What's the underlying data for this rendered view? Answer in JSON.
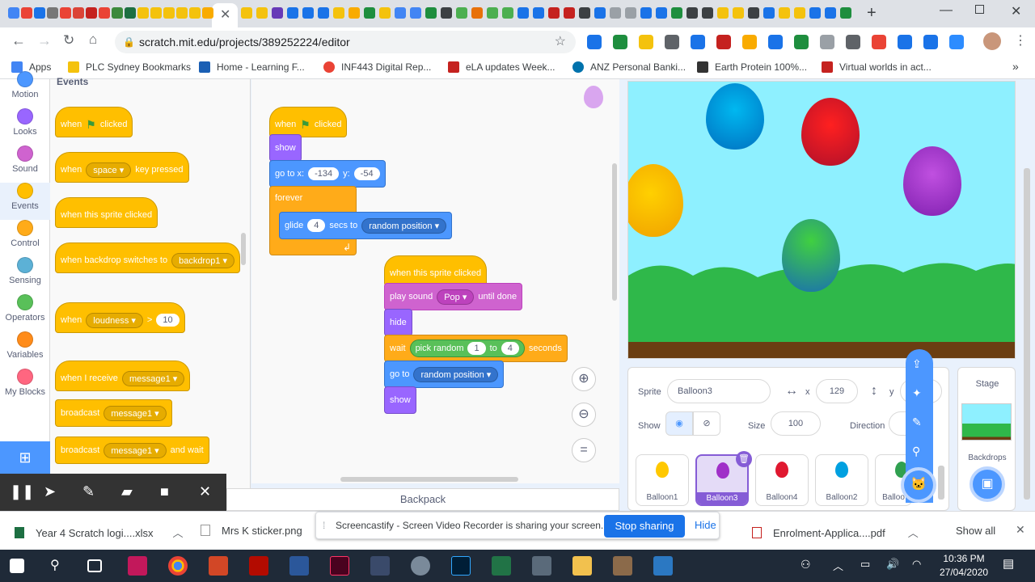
{
  "browser": {
    "url": "scratch.mit.edu/projects/389252224/editor",
    "bookmarks": [
      "Apps",
      "PLC Sydney Bookmarks",
      "Home - Learning F...",
      "INF443 Digital Rep...",
      "eLA updates Week...",
      "ANZ Personal Banki...",
      "Earth Protein 100%...",
      "Virtual worlds in act..."
    ],
    "more_bookmarks": "»"
  },
  "categories": [
    "Motion",
    "Looks",
    "Sound",
    "Events",
    "Control",
    "Sensing",
    "Operators",
    "Variables",
    "My Blocks"
  ],
  "category_colors": [
    "#4c97ff",
    "#9966ff",
    "#cf63cf",
    "#ffbf00",
    "#ffab19",
    "#5cb1d6",
    "#59c059",
    "#ff8c1a",
    "#ff6680"
  ],
  "palette": {
    "heading": "Events",
    "when_flag": [
      "when",
      "clicked"
    ],
    "when_key": [
      "when",
      "space",
      "key pressed"
    ],
    "when_sprite": "when this sprite clicked",
    "when_backdrop": [
      "when backdrop switches to",
      "backdrop1"
    ],
    "when_loudness": [
      "when",
      "loudness",
      ">",
      "10"
    ],
    "when_receive": [
      "when I receive",
      "message1"
    ],
    "broadcast": [
      "broadcast",
      "message1"
    ],
    "broadcast_wait": [
      "broadcast",
      "message1",
      "and wait"
    ]
  },
  "script1": {
    "hat": [
      "when",
      "clicked"
    ],
    "show": "show",
    "goto": [
      "go to x:",
      "-134",
      "y:",
      "-54"
    ],
    "forever": "forever",
    "glide": [
      "glide",
      "4",
      "secs to",
      "random position"
    ]
  },
  "script2": {
    "hat": "when this sprite clicked",
    "play": [
      "play sound",
      "Pop",
      "until done"
    ],
    "hide": "hide",
    "wait": [
      "wait",
      "pick random",
      "1",
      "to",
      "4",
      "seconds"
    ],
    "goto": [
      "go to",
      "random position"
    ],
    "show": "show"
  },
  "backpack": "Backpack",
  "sprite_info": {
    "sprite_label": "Sprite",
    "sprite_name": "Balloon3",
    "x_label": "x",
    "x_value": "129",
    "y_label": "y",
    "show_label": "Show",
    "size_label": "Size",
    "size_value": "100",
    "direction_label": "Direction"
  },
  "sprites": [
    "Balloon1",
    "Balloon3",
    "Balloon4",
    "Balloon2",
    "Balloo"
  ],
  "stage_panel": {
    "title": "Stage",
    "backdrops_label": "Backdrops"
  },
  "downloads": [
    "Year 4 Scratch logi....xlsx",
    "Mrs K sticker.png",
    "Enrolment-Applica....pdf"
  ],
  "show_all": "Show all",
  "sharing": {
    "message": "Screencastify - Screen Video Recorder is sharing your screen.",
    "stop": "Stop sharing",
    "hide": "Hide"
  },
  "clock": {
    "time": "10:36 PM",
    "date": "27/04/2020"
  }
}
